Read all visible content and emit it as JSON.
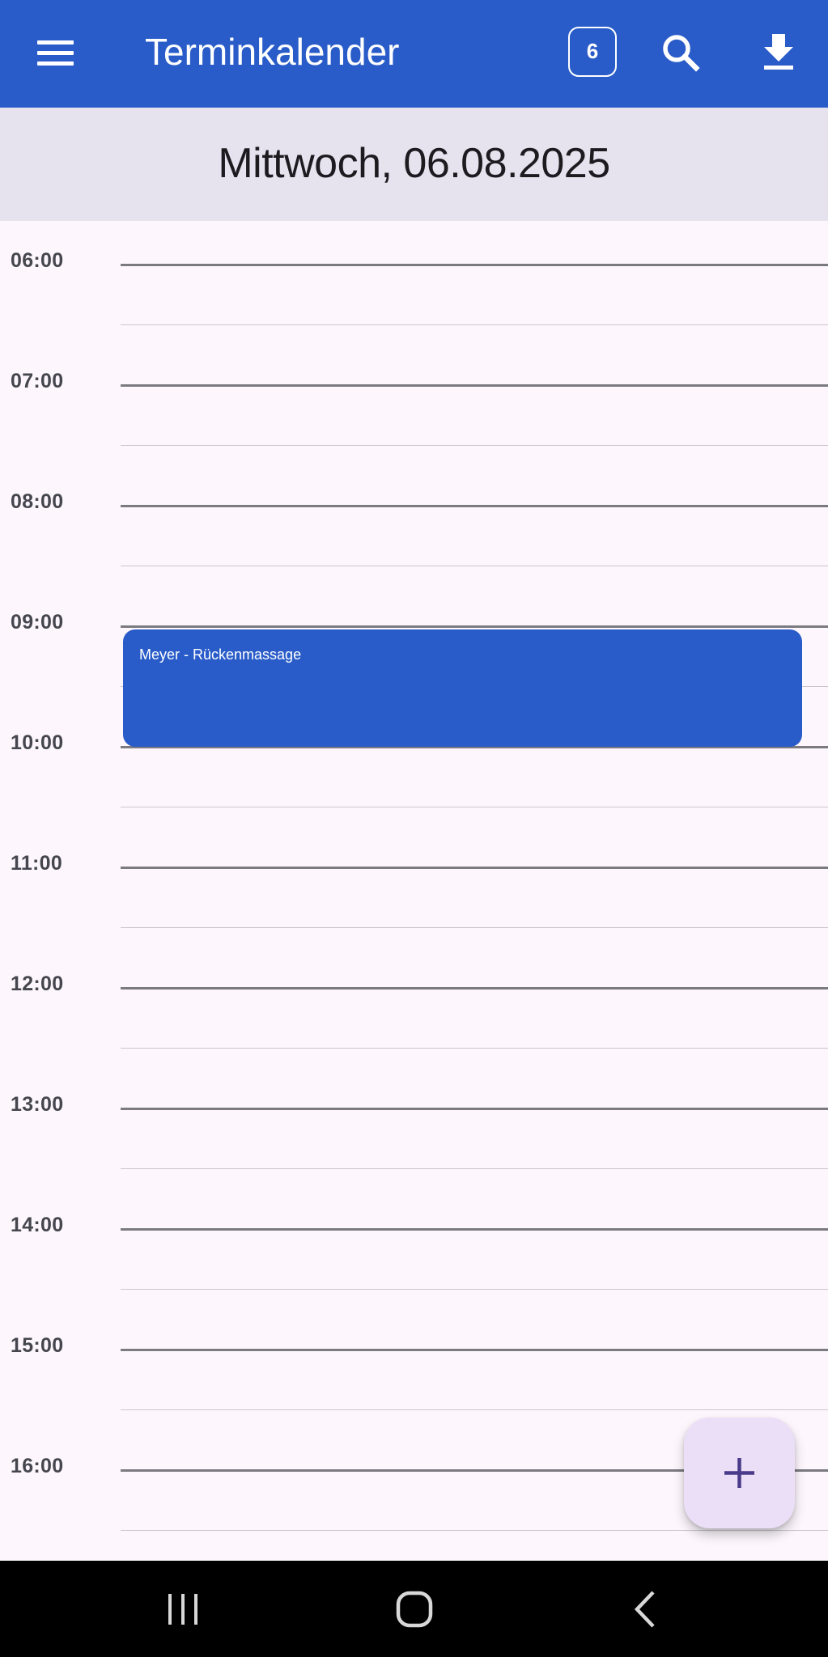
{
  "app_bar": {
    "title": "Terminkalender",
    "today_badge": "6",
    "menu_icon": "menu-icon",
    "search_icon": "search-icon",
    "download_icon": "download-icon",
    "background_color": "#295cc8"
  },
  "date_header": {
    "title": "Mittwoch, 06.08.2025",
    "background_color": "#e6e3ee"
  },
  "timeline": {
    "hours": [
      "06:00",
      "07:00",
      "08:00",
      "09:00",
      "10:00",
      "11:00",
      "12:00",
      "13:00",
      "14:00",
      "15:00",
      "16:00"
    ],
    "events": [
      {
        "title": "Meyer - Rückenmassage",
        "start": "09:00",
        "end": "10:00",
        "color": "#295cc8"
      }
    ]
  },
  "fab": {
    "label": "+",
    "icon": "plus-icon",
    "background_color": "#ebdff8"
  },
  "system_nav": {
    "recents_icon": "recents-icon",
    "home_icon": "home-icon",
    "back_icon": "back-icon"
  }
}
